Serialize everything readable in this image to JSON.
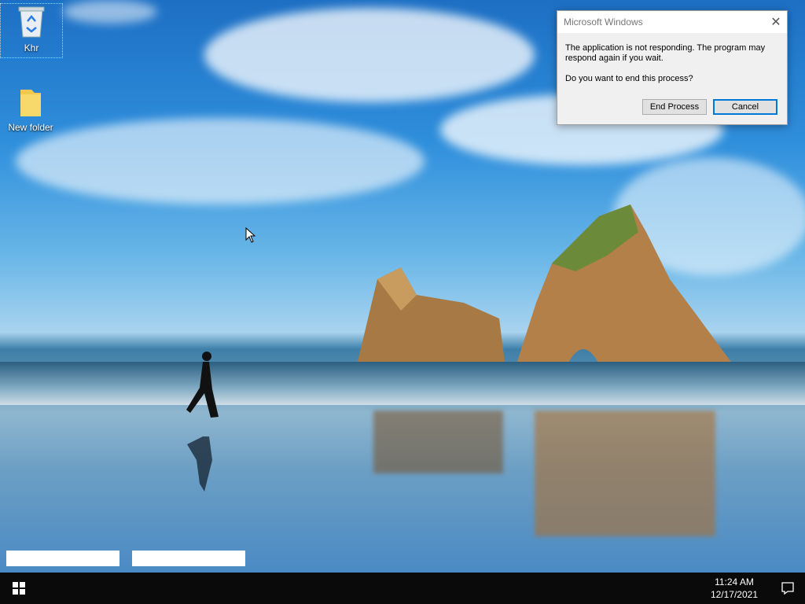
{
  "desktop": {
    "icons": [
      {
        "label": "Khr",
        "icon": "recycle-bin-icon"
      },
      {
        "label": "New folder",
        "icon": "folder-icon"
      }
    ]
  },
  "dialog": {
    "title": "Microsoft Windows",
    "message": "The application is not responding. The program may respond again if you wait.",
    "question": "Do you want to end this process?",
    "end_process_label": "End Process",
    "cancel_label": "Cancel",
    "close_glyph": "✕"
  },
  "taskbar": {
    "time": "11:24 AM",
    "date": "12/17/2021"
  },
  "colors": {
    "taskbar": "#0a0a0a",
    "dialog_bg": "#f0f0f0",
    "accent": "#0078d7"
  }
}
